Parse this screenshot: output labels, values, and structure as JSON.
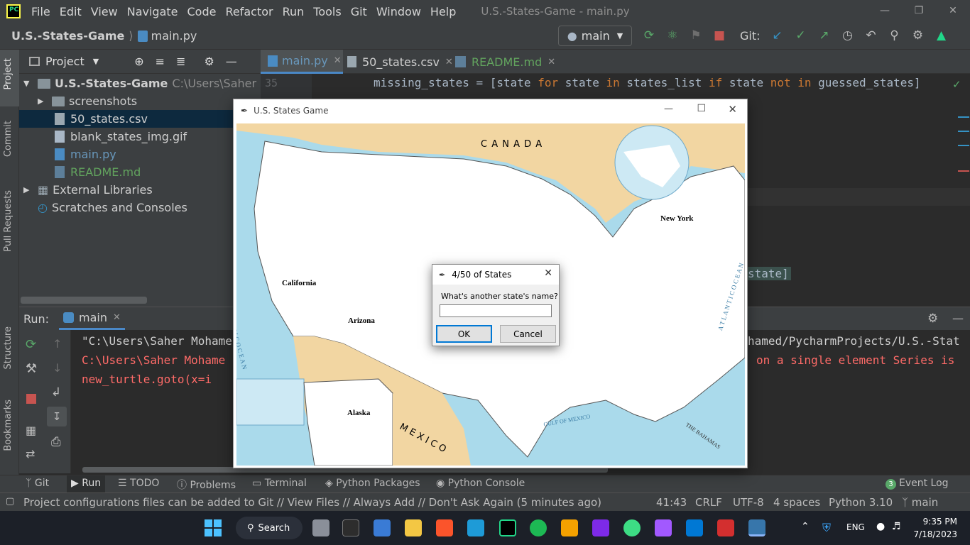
{
  "app": {
    "logo": "PC",
    "window_title": "U.S.-States-Game - main.py",
    "menu": [
      "File",
      "Edit",
      "View",
      "Navigate",
      "Code",
      "Refactor",
      "Run",
      "Tools",
      "Git",
      "Window",
      "Help"
    ],
    "window_controls": [
      "minimize-icon",
      "restore-icon",
      "close-icon"
    ]
  },
  "nav": {
    "project": "U.S.-States-Game",
    "file": "main.py",
    "branch": "main",
    "git_label": "Git:"
  },
  "side_tabs": [
    "Project",
    "Commit",
    "Pull Requests",
    "Structure",
    "Bookmarks"
  ],
  "project_panel": {
    "title": "Project",
    "root_name": "U.S.-States-Game",
    "root_path": "C:\\Users\\Saher Moha",
    "items": [
      {
        "label": "screenshots",
        "kind": "folder"
      },
      {
        "label": "50_states.csv",
        "kind": "csv"
      },
      {
        "label": "blank_states_img.gif",
        "kind": "gif"
      },
      {
        "label": "main.py",
        "kind": "py"
      },
      {
        "label": "README.md",
        "kind": "md"
      }
    ],
    "external": "External Libraries",
    "scratches": "Scratches and Consoles"
  },
  "editor": {
    "tabs": [
      {
        "label": "main.py",
        "active": true
      },
      {
        "label": "50_states.csv",
        "active": false
      },
      {
        "label": "README.md",
        "active": false
      }
    ],
    "line_number": "35",
    "code_line": {
      "p1": "missing_states = [state ",
      "k1": "for",
      "p2": " state ",
      "k2": "in",
      "p3": " states_list ",
      "k3": "if",
      "p4": " state ",
      "k4": "not in",
      "p5": " guessed_states]"
    },
    "code_partial": "state]"
  },
  "run_panel": {
    "label": "Run:",
    "config": "main",
    "output_lines": [
      {
        "left": "\"C:\\Users\\Saher Mohame",
        "right": "hamed/PycharmProjects/U.S.-Stat",
        "color": "#cfcfcf"
      },
      {
        "left": "C:\\Users\\Saher Mohame",
        "right": "on a single element Series is",
        "color": "#ff6b68"
      },
      {
        "left": "  new_turtle.goto(x=i",
        "right": "",
        "color": "#ff6b68"
      }
    ]
  },
  "tool_tabs": [
    "Git",
    "Run",
    "TODO",
    "Problems",
    "Terminal",
    "Python Packages",
    "Python Console"
  ],
  "event_log": {
    "count": "3",
    "label": "Event Log"
  },
  "status_bar": {
    "message": "Project configurations files can be added to Git // View Files // Always Add // Don't Ask Again (5 minutes ago)",
    "position": "41:43",
    "line_sep": "CRLF",
    "encoding": "UTF-8",
    "indent": "4 spaces",
    "interpreter": "Python 3.10",
    "branch": "main"
  },
  "turtle_window": {
    "title": "U.S. States Game",
    "map_labels": {
      "canada": "C A N A D A",
      "mexico": "M E X I C O",
      "pacific": "P A C I F I C   O C E A N",
      "atlantic": "A T L A N T I C   O C E A N",
      "gulf": "GULF OF MEXICO",
      "bahamas": "THE BAHAMAS"
    },
    "state_labels": [
      "New York",
      "California",
      "Arizona",
      "Alaska"
    ]
  },
  "dialog": {
    "title": "4/50 of States",
    "prompt": "What's another state's name?",
    "input_value": "",
    "ok": "OK",
    "cancel": "Cancel"
  },
  "taskbar": {
    "search": "Search",
    "language": "ENG",
    "time": "9:35 PM",
    "date": "7/18/2023"
  }
}
